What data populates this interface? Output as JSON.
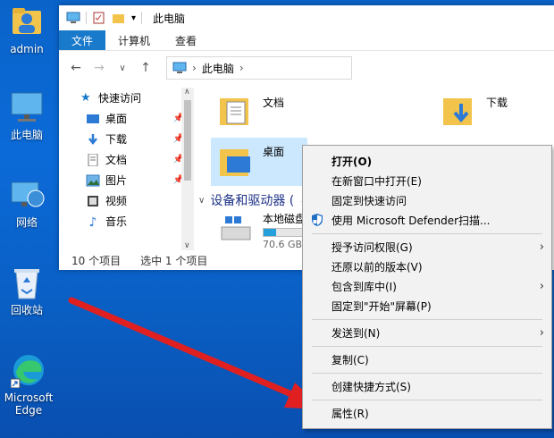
{
  "desktop": {
    "icons": [
      {
        "label": "admin"
      },
      {
        "label": "此电脑"
      },
      {
        "label": "网络"
      },
      {
        "label": "回收站"
      },
      {
        "label": "Microsoft Edge"
      }
    ]
  },
  "window": {
    "title": "此电脑",
    "tabs": [
      {
        "label": "文件"
      },
      {
        "label": "计算机"
      },
      {
        "label": "查看"
      }
    ],
    "address": "此电脑",
    "sidebar": [
      {
        "label": "快速访问"
      },
      {
        "label": "桌面"
      },
      {
        "label": "下载"
      },
      {
        "label": "文档"
      },
      {
        "label": "图片"
      },
      {
        "label": "视频"
      },
      {
        "label": "音乐"
      }
    ],
    "content": {
      "items": [
        {
          "label": "文档"
        },
        {
          "label": "下载"
        },
        {
          "label": "桌面"
        }
      ],
      "group_header": "设备和驱动器 (",
      "disk_label": "本地磁盘",
      "disk_free_partial": "70.6 GB"
    },
    "status": {
      "count": "10 个项目",
      "selected": "选中 1 个项目"
    }
  },
  "context_menu": {
    "items": [
      {
        "label": "打开(O)"
      },
      {
        "label": "在新窗口中打开(E)"
      },
      {
        "label": "固定到快速访问"
      },
      {
        "label": "使用 Microsoft Defender扫描..."
      },
      {
        "label": "授予访问权限(G)"
      },
      {
        "label": "还原以前的版本(V)"
      },
      {
        "label": "包含到库中(I)"
      },
      {
        "label": "固定到\"开始\"屏幕(P)"
      },
      {
        "label": "发送到(N)"
      },
      {
        "label": "复制(C)"
      },
      {
        "label": "创建快捷方式(S)"
      },
      {
        "label": "属性(R)"
      }
    ]
  },
  "colors": {
    "accent": "#1979ca",
    "arrow": "#e02020",
    "selection": "#cce8ff"
  }
}
